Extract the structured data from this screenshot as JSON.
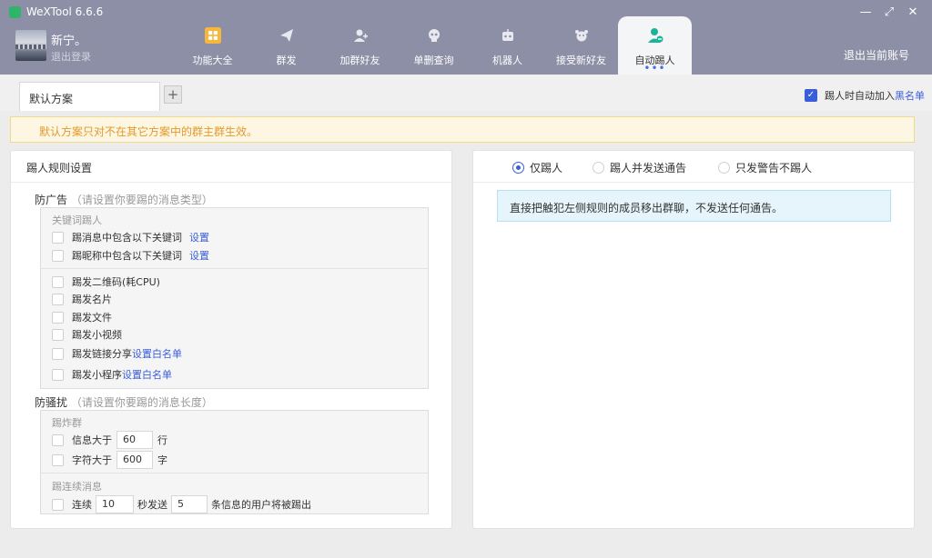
{
  "app": {
    "title": "WeXTool 6.6.6"
  },
  "window": {
    "minimize": "—",
    "maximize": "⤢",
    "close": "✕"
  },
  "user": {
    "name": "新宁。",
    "logout": "退出登录"
  },
  "nav": {
    "items": [
      {
        "label": "功能大全",
        "icon": "grid-icon"
      },
      {
        "label": "群发",
        "icon": "send-icon"
      },
      {
        "label": "加群好友",
        "icon": "add-user-icon"
      },
      {
        "label": "单删查询",
        "icon": "skull-icon"
      },
      {
        "label": "机器人",
        "icon": "robot-icon"
      },
      {
        "label": "接受新好友",
        "icon": "handshake-icon"
      },
      {
        "label": "自动踢人",
        "icon": "remove-user-icon",
        "active": true
      }
    ],
    "more": "•••",
    "logout_account": "退出当前账号"
  },
  "tabs": {
    "items": [
      "默认方案"
    ],
    "add": "+"
  },
  "auto_blacklist": {
    "label": "踢人时自动加入",
    "link": "黑名单",
    "checked": true
  },
  "notice": "默认方案只对不在其它方案中的群主群生效。",
  "left_panel": {
    "title": "踢人规则设置",
    "ad": {
      "title": "防广告",
      "hint": "（请设置你要踢的消息类型）",
      "keyword_caption": "关键词踢人",
      "keyword_items": [
        {
          "label": "踢消息中包含以下关键词",
          "link": "设置"
        },
        {
          "label": "踢昵称中包含以下关键词",
          "link": "设置"
        }
      ],
      "items": [
        {
          "label": "踢发二维码(耗CPU)",
          "link": ""
        },
        {
          "label": "踢发名片",
          "link": ""
        },
        {
          "label": "踢发文件",
          "link": ""
        },
        {
          "label": "踢发小视频",
          "link": ""
        },
        {
          "label": "踢发链接分享",
          "link": "设置白名单"
        },
        {
          "label": "踢发小程序",
          "link": "设置白名单"
        }
      ]
    },
    "spam": {
      "title": "防骚扰",
      "hint": "（请设置你要踢的消息长度）",
      "bomb_caption": "踢炸群",
      "msg_gt": {
        "label": "信息大于",
        "value": "60",
        "unit": "行"
      },
      "char_gt": {
        "label": "字符大于",
        "value": "600",
        "unit": "字"
      },
      "continuous_caption": "踢连续消息",
      "continuous": {
        "label": "连续",
        "seconds": "10",
        "mid": "秒发送",
        "count": "5",
        "tail": "条信息的用户将被踢出"
      }
    }
  },
  "right_panel": {
    "options": [
      {
        "label": "仅踢人",
        "selected": true
      },
      {
        "label": "踢人并发送通告",
        "selected": false
      },
      {
        "label": "只发警告不踢人",
        "selected": false
      }
    ],
    "info": "直接把触犯左侧规则的成员移出群聊，不发送任何通告。"
  }
}
